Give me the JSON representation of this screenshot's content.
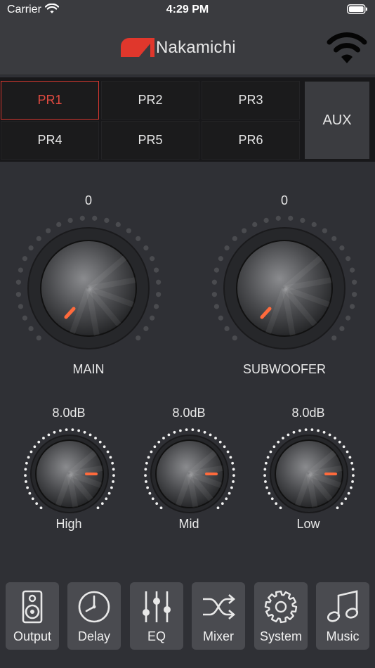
{
  "status_bar": {
    "carrier": "Carrier",
    "time": "4:29 PM"
  },
  "header": {
    "brand": "Nakamichi",
    "accent": "#e0372c"
  },
  "presets": {
    "items": [
      "PR1",
      "PR2",
      "PR3",
      "PR4",
      "PR5",
      "PR6"
    ],
    "active": "PR1",
    "source": "AUX"
  },
  "volume_knobs": [
    {
      "label": "MAIN",
      "value": "0"
    },
    {
      "label": "SUBWOOFER",
      "value": "0"
    }
  ],
  "tone_knobs": [
    {
      "label": "High",
      "value": "8.0dB"
    },
    {
      "label": "Mid",
      "value": "8.0dB"
    },
    {
      "label": "Low",
      "value": "8.0dB"
    }
  ],
  "nav": {
    "items": [
      {
        "label": "Output",
        "icon": "speaker-icon"
      },
      {
        "label": "Delay",
        "icon": "clock-icon"
      },
      {
        "label": "EQ",
        "icon": "sliders-icon"
      },
      {
        "label": "Mixer",
        "icon": "shuffle-icon"
      },
      {
        "label": "System",
        "icon": "gear-icon"
      },
      {
        "label": "Music",
        "icon": "music-note-icon"
      }
    ]
  }
}
